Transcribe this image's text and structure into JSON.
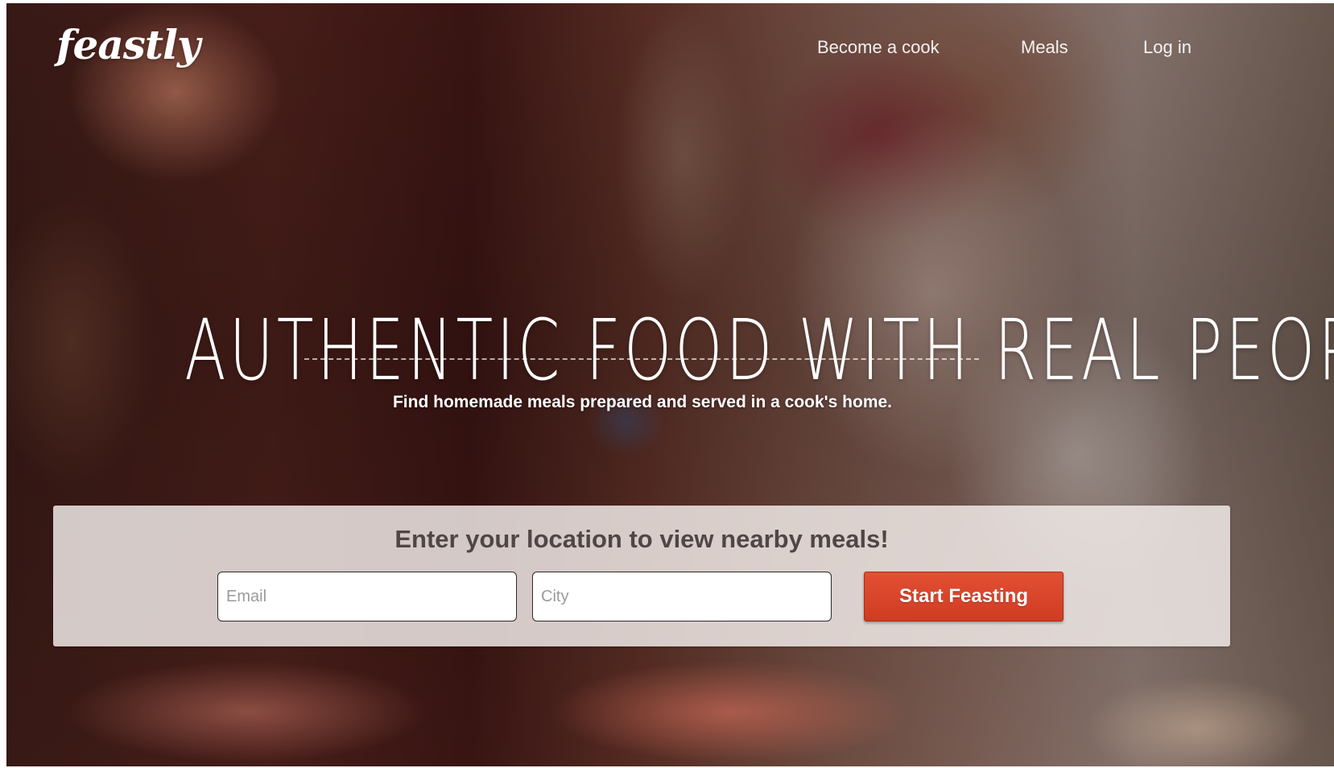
{
  "brand": {
    "logo_text": "feastly"
  },
  "nav": {
    "items": [
      {
        "label": "Become a cook"
      },
      {
        "label": "Meals"
      },
      {
        "label": "Log in"
      }
    ]
  },
  "hero": {
    "title": "AUTHENTIC FOOD WITH REAL PEOPLE",
    "subtitle": "Find homemade meals prepared and served in a cook's home."
  },
  "search": {
    "heading": "Enter your location to view nearby meals!",
    "email_placeholder": "Email",
    "city_placeholder": "City",
    "submit_label": "Start Feasting"
  },
  "colors": {
    "accent": "#d8432a",
    "panel": "#f2ecea",
    "heading_text": "#504646"
  }
}
